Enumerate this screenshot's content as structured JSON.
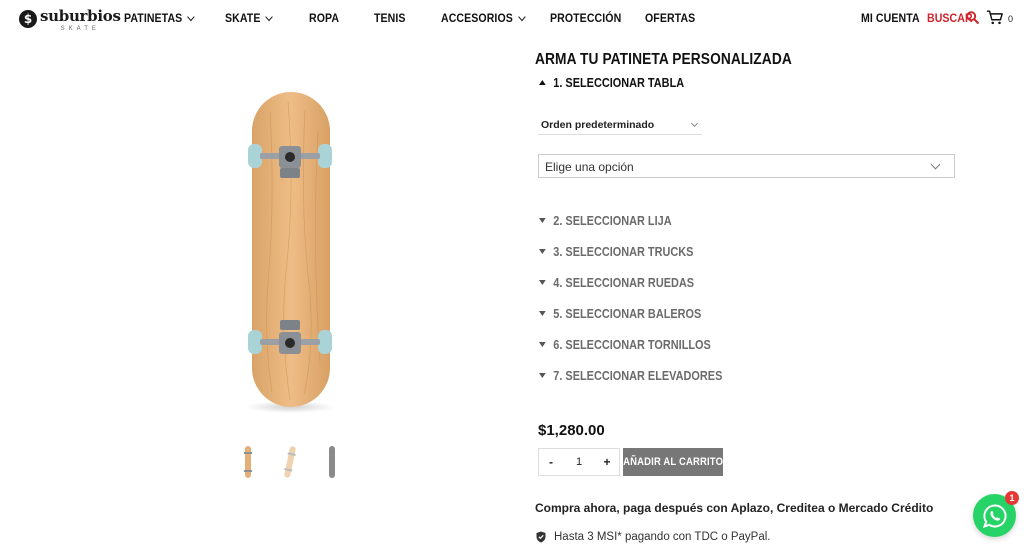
{
  "header": {
    "logo_main": "suburbios",
    "logo_sub": "SKATE",
    "nav": [
      {
        "label": "PATINETAS",
        "has_dropdown": true
      },
      {
        "label": "SKATE",
        "has_dropdown": true
      },
      {
        "label": "ROPA",
        "has_dropdown": false
      },
      {
        "label": "TENIS",
        "has_dropdown": false
      },
      {
        "label": "ACCESORIOS",
        "has_dropdown": true
      },
      {
        "label": "PROTECCIÓN",
        "has_dropdown": false
      },
      {
        "label": "OFERTAS",
        "has_dropdown": false
      }
    ],
    "account_label": "MI CUENTA",
    "search_label": "BUSCAR",
    "cart_count": "0",
    "accent_color": "#d0232a"
  },
  "product": {
    "title": "ARMA TU PATINETA PERSONALIZADA",
    "steps": [
      {
        "label": "1. SELECCIONAR TABLA",
        "expanded": true
      },
      {
        "label": "2. SELECCIONAR LIJA",
        "expanded": false
      },
      {
        "label": "3. SELECCIONAR TRUCKS",
        "expanded": false
      },
      {
        "label": "4. SELECCIONAR RUEDAS",
        "expanded": false
      },
      {
        "label": "5. SELECCIONAR BALEROS",
        "expanded": false
      },
      {
        "label": "6. SELECCIONAR TORNILLOS",
        "expanded": false
      },
      {
        "label": "7. SELECCIONAR ELEVADORES",
        "expanded": false
      }
    ],
    "sort_value": "Orden predeterminado",
    "option_value": "Elige una opción",
    "price": "$1,280.00",
    "quantity": "1",
    "qty_minus": "-",
    "qty_plus": "+",
    "add_to_cart_label": "AÑADIR AL CARRITO",
    "promo_text": "Compra ahora, paga después con Aplazo, Creditea o Mercado Crédito",
    "msi_text": "Hasta 3 MSI* pagando con TDC o PayPal.",
    "thumbnails": [
      "board-bottom-thumb",
      "board-angled-thumb",
      "board-grip-thumb"
    ],
    "deck_color": "#e6b47c",
    "wheel_color": "#a9d3d6"
  },
  "whatsapp": {
    "badge_count": "1",
    "color": "#25d366"
  }
}
